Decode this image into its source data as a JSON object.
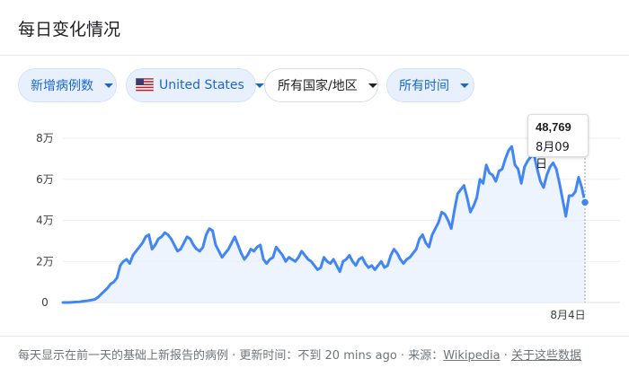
{
  "header": {
    "title": "每日变化情况"
  },
  "filters": {
    "metric": "新增病例数",
    "country": "United States",
    "region": "所有国家/地区",
    "time": "所有时间"
  },
  "colors": {
    "line": "#4285f4",
    "fill": "#e8f0fe",
    "grid": "#eeeeee",
    "chip_bg": "#e8f0fe",
    "chip_text": "#1967d2"
  },
  "tooltip": {
    "value": "48,769",
    "date": "8月09日"
  },
  "chart_data": {
    "type": "area",
    "title": "",
    "xlabel": "",
    "ylabel": "",
    "ylim": [
      0,
      80000
    ],
    "yticks": [
      0,
      20000,
      40000,
      60000,
      80000
    ],
    "ytick_labels": [
      "0",
      "2万",
      "4万",
      "6万",
      "8万"
    ],
    "xtick_labels": [
      "8月4日"
    ],
    "grid": true,
    "series": [
      {
        "values": [
          0,
          0,
          0,
          100,
          200,
          300,
          500,
          700,
          900,
          1200,
          1500,
          2500,
          4000,
          5500,
          7000,
          9000,
          10000,
          12000,
          18000,
          20000,
          21000,
          19000,
          23000,
          25000,
          27000,
          29000,
          32000,
          33000,
          26000,
          28000,
          31000,
          32000,
          34000,
          33000,
          31000,
          28000,
          25000,
          26000,
          29000,
          32000,
          31000,
          28000,
          26000,
          25000,
          27000,
          33000,
          36000,
          35000,
          28000,
          25000,
          22000,
          24000,
          26000,
          29000,
          32000,
          28000,
          24000,
          21000,
          23000,
          26000,
          25000,
          27000,
          28000,
          21000,
          19000,
          21000,
          22000,
          27000,
          25000,
          23000,
          20000,
          22000,
          21000,
          20000,
          22000,
          25000,
          23000,
          21000,
          20000,
          18000,
          16000,
          17000,
          22000,
          20000,
          19000,
          21000,
          18000,
          15000,
          20000,
          21000,
          23000,
          20000,
          18000,
          21000,
          22000,
          19000,
          17000,
          18000,
          16000,
          18000,
          20000,
          17000,
          18000,
          23000,
          26000,
          24000,
          21000,
          19000,
          21000,
          22000,
          24000,
          26000,
          31000,
          33000,
          29000,
          27000,
          33000,
          36000,
          39000,
          44000,
          43000,
          40000,
          36000,
          45000,
          53000,
          55000,
          57000,
          51000,
          44000,
          47000,
          51000,
          60000,
          58000,
          67000,
          63000,
          62000,
          59000,
          64000,
          65000,
          70000,
          74000,
          76000,
          67000,
          65000,
          58000,
          66000,
          69000,
          71000,
          72000,
          65000,
          59000,
          56000,
          62000,
          66000,
          68000,
          65000,
          58000,
          50000,
          42000,
          52000,
          52000,
          54000,
          61000,
          56000,
          48769
        ]
      }
    ]
  },
  "footer": {
    "text": "每天显示在前一天的基础上新报告的病例 · 更新时间：不到 20 mins ago · 来源：",
    "source_link": "Wikipedia",
    "sep": " · ",
    "about_link": "关于这些数据"
  }
}
